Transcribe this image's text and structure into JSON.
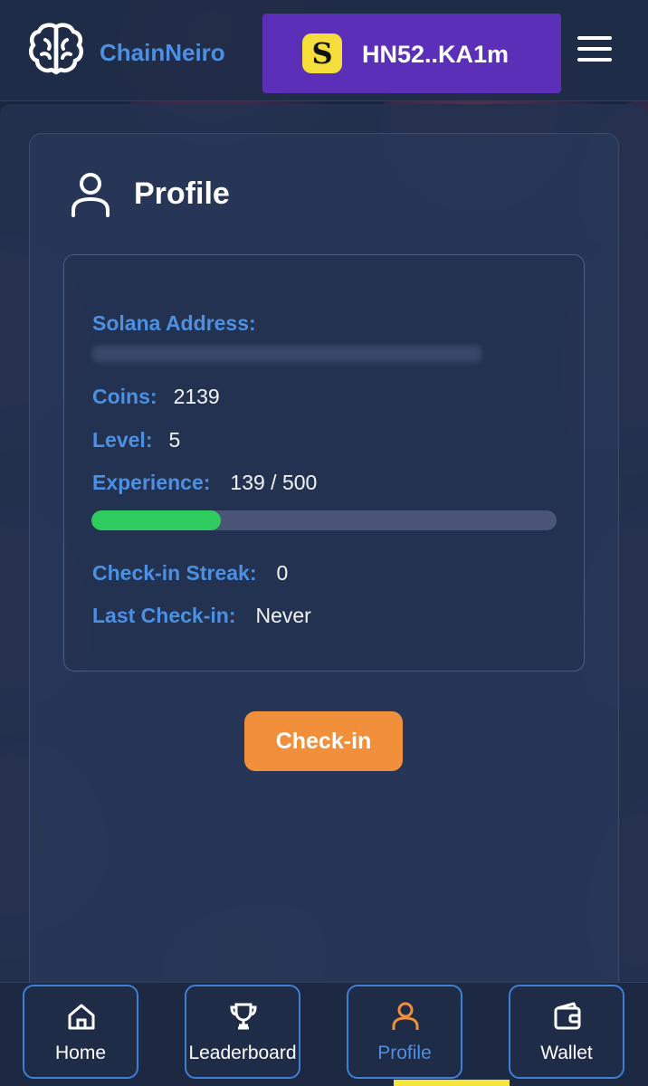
{
  "header": {
    "brand": "ChainNeiro",
    "wallet_logo": "S",
    "wallet_address": "HN52..KA1m",
    "icons": {
      "logo": "brain-icon",
      "menu": "hamburger-menu-icon",
      "wallet": "solana-logo-icon"
    }
  },
  "profile": {
    "title": "Profile",
    "icon": "user-icon",
    "fields": {
      "solana_address_label": "Solana Address:",
      "coins_label": "Coins:",
      "coins_value": "2139",
      "level_label": "Level:",
      "level_value": "5",
      "experience_label": "Experience:",
      "experience_value": "139 / 500",
      "experience_progress": 0.278,
      "streak_label": "Check-in Streak:",
      "streak_value": "0",
      "last_checkin_label": "Last Check-in:",
      "last_checkin_value": "Never"
    },
    "checkin_button": "Check-in"
  },
  "nav": {
    "items": [
      {
        "label": "Home",
        "icon": "home-icon",
        "active": false
      },
      {
        "label": "Leaderboard",
        "icon": "trophy-icon",
        "active": false
      },
      {
        "label": "Profile",
        "icon": "user-icon",
        "active": true
      },
      {
        "label": "Wallet",
        "icon": "wallet-icon",
        "active": false
      }
    ]
  },
  "colors": {
    "accent_blue": "#4b90e2",
    "wallet_purple": "#5b2fb8",
    "checkin_orange": "#f18f3b",
    "progress_green": "#2ecc5f",
    "active_nav": "#f18f3b"
  }
}
